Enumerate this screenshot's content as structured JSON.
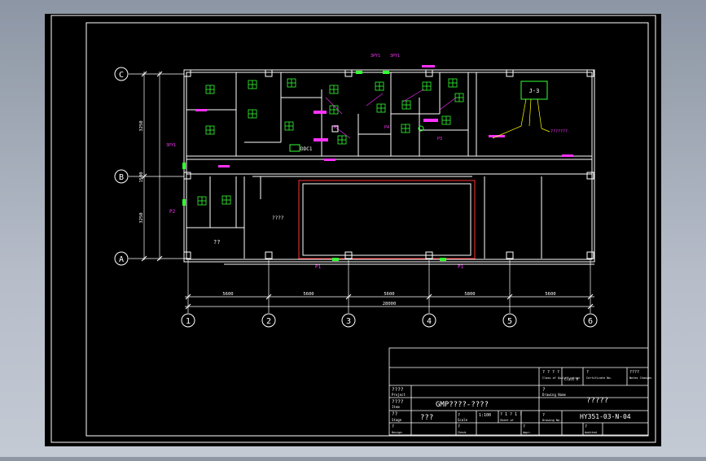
{
  "colors": {
    "background": "#000000",
    "line": "#ffffff",
    "axis": "#ffffff",
    "dimension": "#ffffff",
    "magenta": "#ff33ff",
    "green": "#33ff33",
    "yellow": "#ffff00",
    "cyan": "#00ffff",
    "red": "#ff3333"
  },
  "grid_axes": {
    "rows": [
      "C",
      "B",
      "A"
    ],
    "columns": [
      "1",
      "2",
      "3",
      "4",
      "5",
      "6"
    ]
  },
  "dimensions": {
    "bays": [
      "5600",
      "5600",
      "5600",
      "5800",
      "5600"
    ],
    "overall": "28000",
    "side": [
      "3250",
      "1500",
      "3250"
    ]
  },
  "room_labels": {
    "center": "????",
    "lower_left": "??"
  },
  "equipment_labels": {
    "panel_j3": "J-3",
    "panel_note": "???????",
    "p1_left": "P1",
    "p1_right": "P1",
    "p2": "P2",
    "p3": "P3",
    "p4": "P4",
    "p5": "P5",
    "vent_3py1_left": "3PY1",
    "vent_3py1_right": "3PY1",
    "vent_3py1_side": "3PY1",
    "door_label": "DDC1"
  },
  "title_block": {
    "class_label": "? ? ? ?",
    "class_sub": "Class of Qualification",
    "grade": "Class  A",
    "cert_label": "Certificate No.",
    "cert_value": "?",
    "note_label": "????",
    "note_sub": "Notes Changes",
    "project_label": "????",
    "project_sub": "Project",
    "project_value": "GMP????-????",
    "drawing_label": "?",
    "drawing_sub": "Drawing Name",
    "drawing_value": "?????",
    "item_label": "????",
    "item_sub": "Item",
    "item_value": "???",
    "scale_label": "?",
    "scale_sub": "Scale",
    "scale_value": "1:100",
    "sheet_label": "?  1  ?  1  ?",
    "sheet_sub": "Sheet  of",
    "drawing_no_label": "?",
    "drawing_no_sub": "Drawing No.",
    "drawing_no_value": "HY351-03-N-04",
    "stage_label": "??",
    "stage_sub": "Stage",
    "design_label": "?",
    "design_sub": "Design",
    "check_label": "?",
    "check_sub": "Check",
    "approve_label": "?",
    "approve_sub": "Appr.",
    "audit_label": "?",
    "audit_sub": "Audited"
  }
}
